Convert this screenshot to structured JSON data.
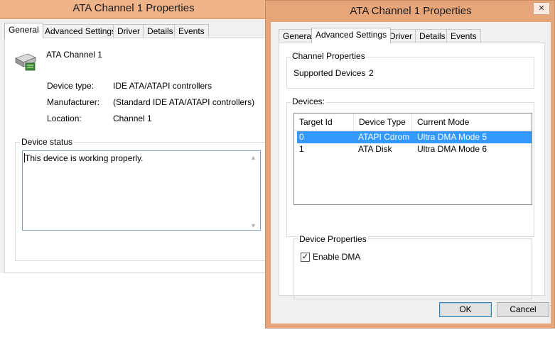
{
  "window_back": {
    "title": "ATA Channel 1 Properties",
    "tabs": [
      {
        "label": "General",
        "active": true
      },
      {
        "label": "Advanced Settings",
        "active": false
      },
      {
        "label": "Driver",
        "active": false
      },
      {
        "label": "Details",
        "active": false
      },
      {
        "label": "Events",
        "active": false
      }
    ],
    "device_name": "ATA Channel 1",
    "device_icon": "ide-controller-icon",
    "properties": [
      {
        "label": "Device type:",
        "value": "IDE ATA/ATAPI controllers"
      },
      {
        "label": "Manufacturer:",
        "value": "(Standard IDE ATA/ATAPI controllers)"
      },
      {
        "label": "Location:",
        "value": "Channel 1"
      }
    ],
    "status_group_label": "Device status",
    "status_text": "This device is working properly."
  },
  "window_front": {
    "title": "ATA Channel 1 Properties",
    "close_glyph": "✕",
    "tabs": [
      {
        "label": "General",
        "active": false
      },
      {
        "label": "Advanced Settings",
        "active": true
      },
      {
        "label": "Driver",
        "active": false
      },
      {
        "label": "Details",
        "active": false
      },
      {
        "label": "Events",
        "active": false
      }
    ],
    "channel_properties": {
      "group_label": "Channel Properties",
      "supported_devices_label": "Supported Devices",
      "supported_devices_value": "2"
    },
    "devices": {
      "group_label": "Devices:",
      "columns": [
        "Target Id",
        "Device Type",
        "Current Mode"
      ],
      "rows": [
        {
          "target_id": "0",
          "device_type": "ATAPI Cdrom",
          "current_mode": "Ultra DMA Mode 5",
          "selected": true
        },
        {
          "target_id": "1",
          "device_type": "ATA Disk",
          "current_mode": "Ultra DMA Mode 6",
          "selected": false
        }
      ]
    },
    "device_properties": {
      "group_label": "Device Properties",
      "enable_dma_label": "Enable DMA",
      "enable_dma_checked": true,
      "check_glyph": "✓"
    },
    "buttons": {
      "ok": "OK",
      "cancel": "Cancel"
    }
  },
  "colors": {
    "title_bar_active": "#e7a57a",
    "title_bar_inactive": "#efb38a",
    "selection": "#3399ff"
  }
}
